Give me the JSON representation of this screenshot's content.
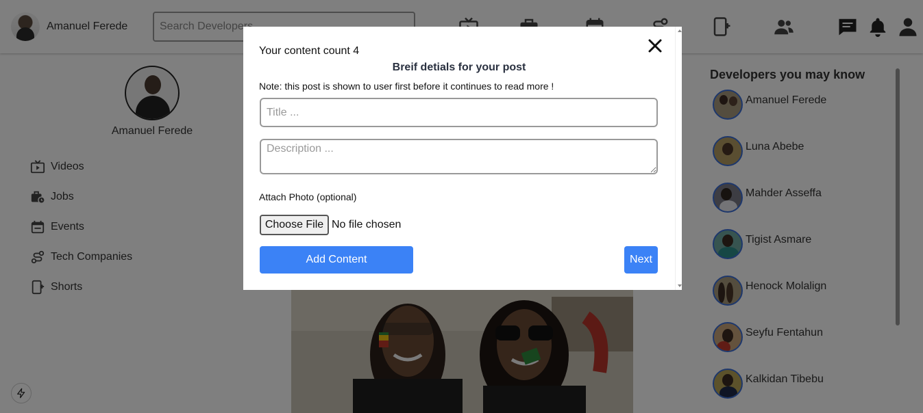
{
  "header": {
    "username": "Amanuel Ferede",
    "search_placeholder": "Search Developers",
    "nav_icons": [
      "tv-icon",
      "briefcase-icon",
      "calendar-icon",
      "route-icon",
      "mobile-plus-icon",
      "people-icon",
      "chat-icon",
      "bell-icon",
      "user-icon"
    ]
  },
  "sidebar": {
    "profile_name": "Amanuel Ferede",
    "items": [
      {
        "label": "Videos",
        "icon": "video-icon"
      },
      {
        "label": "Jobs",
        "icon": "jobs-icon"
      },
      {
        "label": "Events",
        "icon": "calendar-icon"
      },
      {
        "label": "Tech Companies",
        "icon": "route-icon"
      },
      {
        "label": "Shorts",
        "icon": "mobile-plus-icon"
      }
    ]
  },
  "right_panel": {
    "heading": "Developers you may know",
    "developers": [
      {
        "name": "Amanuel Ferede"
      },
      {
        "name": "Luna Abebe"
      },
      {
        "name": "Mahder Asseffa"
      },
      {
        "name": "Tigist Asmare"
      },
      {
        "name": "Henock Molalign"
      },
      {
        "name": "Seyfu Fentahun"
      },
      {
        "name": "Kalkidan Tibebu"
      }
    ]
  },
  "modal": {
    "content_count": "Your content count 4",
    "title": "Breif detials for your post",
    "note": "Note: this post is shown to user first before it continues to read more !",
    "title_placeholder": "Title ...",
    "description_placeholder": "Description ...",
    "attach_label": "Attach Photo (optional)",
    "file_button": "Choose File",
    "file_status": "No file chosen",
    "add_button": "Add Content",
    "next_button": "Next"
  },
  "colors": {
    "accent": "#3b82f6",
    "overlay": "rgba(0,0,0,0.5)"
  }
}
